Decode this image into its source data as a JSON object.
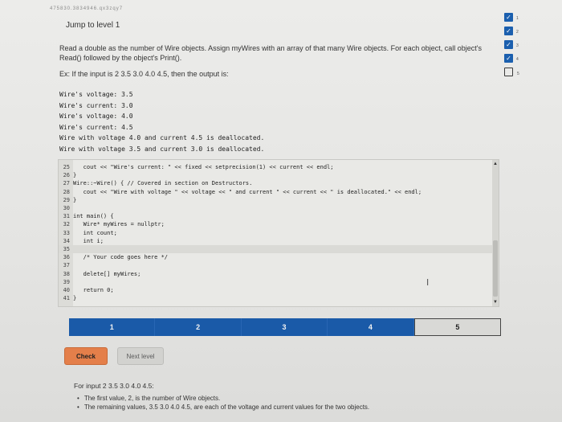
{
  "header": {
    "page_id_text": "475830.3834946.qx3zqy7"
  },
  "jump_link": "Jump to level 1",
  "description": {
    "text": "Read a double as the number of Wire objects. Assign myWires with an array of that many Wire objects. For each object, call object's Read() followed by the object's Print().",
    "example": "Ex: If the input is 2 3.5 3.0 4.0 4.5, then the output is:"
  },
  "expected_output": [
    "Wire's voltage: 3.5",
    "Wire's current: 3.0",
    "Wire's voltage: 4.0",
    "Wire's current: 4.5",
    "Wire with voltage 4.0 and current 4.5 is deallocated.",
    "Wire with voltage 3.5 and current 3.0 is deallocated."
  ],
  "code": {
    "lines": [
      {
        "n": "25",
        "t": "   cout << \"Wire's current: \" << fixed << setprecision(1) << current << endl;"
      },
      {
        "n": "26",
        "t": "}"
      },
      {
        "n": "27",
        "t": "Wire::~Wire() { // Covered in section on Destructors."
      },
      {
        "n": "28",
        "t": "   cout << \"Wire with voltage \" << voltage << \" and current \" << current << \" is deallocated.\" << endl;"
      },
      {
        "n": "29",
        "t": "}"
      },
      {
        "n": "30",
        "t": ""
      },
      {
        "n": "31",
        "t": "int main() {"
      },
      {
        "n": "32",
        "t": "   Wire* myWires = nullptr;"
      },
      {
        "n": "33",
        "t": "   int count;"
      },
      {
        "n": "34",
        "t": "   int i;"
      },
      {
        "n": "35",
        "t": ""
      },
      {
        "n": "36",
        "t": "   /* Your code goes here */"
      },
      {
        "n": "37",
        "t": ""
      },
      {
        "n": "38",
        "t": "   delete[] myWires;"
      },
      {
        "n": "39",
        "t": ""
      },
      {
        "n": "40",
        "t": "   return 0;"
      },
      {
        "n": "41",
        "t": "}"
      }
    ],
    "active_line": "35"
  },
  "levels": {
    "items": [
      "1",
      "2",
      "3",
      "4",
      "5"
    ],
    "current": "5"
  },
  "buttons": {
    "check": "Check",
    "next": "Next level"
  },
  "feedback": {
    "heading": "For input 2 3.5 3.0 4.0 4.5:",
    "bullets": [
      "The first value, 2, is the number of Wire objects.",
      "The remaining values, 3.5 3.0 4.0 4.5, are each of the voltage and current values for the two objects."
    ]
  },
  "progress_checks": [
    {
      "label": "1",
      "done": true
    },
    {
      "label": "2",
      "done": true
    },
    {
      "label": "3",
      "done": true
    },
    {
      "label": "4",
      "done": true
    },
    {
      "label": "5",
      "done": false
    }
  ],
  "colors": {
    "level_bar": "#1a5aa8",
    "check_button": "#e47f4a",
    "check_complete": "#1b5fae"
  }
}
